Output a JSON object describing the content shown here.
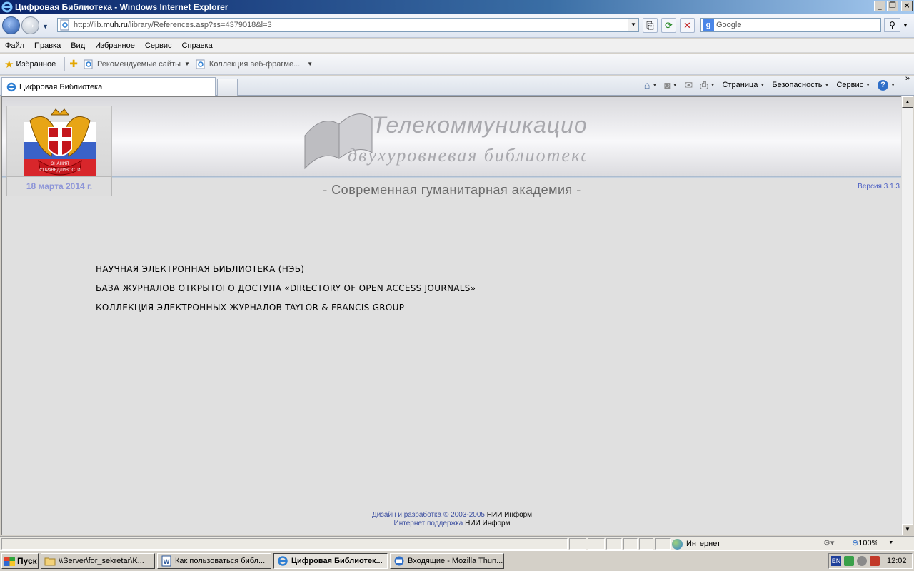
{
  "window": {
    "title": "Цифровая Библиотека - Windows Internet Explorer"
  },
  "address": {
    "url_prefix": "http://lib.",
    "url_host": "muh.ru",
    "url_rest": "/library/References.asp?ss=4379018&l=3"
  },
  "search": {
    "placeholder": "Google"
  },
  "menu": [
    "Файл",
    "Правка",
    "Вид",
    "Избранное",
    "Сервис",
    "Справка"
  ],
  "favorites": {
    "label": "Избранное",
    "links": [
      "Рекомендуемые сайты",
      "Коллекция веб-фрагме..."
    ]
  },
  "tab": {
    "label": "Цифровая Библиотека"
  },
  "commandbar": {
    "page": "Страница",
    "security": "Безопасность",
    "service": "Сервис"
  },
  "page": {
    "date": "18 марта 2014 г.",
    "subtitle": "- Современная гуманитарная академия -",
    "version": "Версия 3.1.3",
    "banner_line1": "Телекоммуникационная",
    "banner_line2": "двухуровневая библиотека",
    "crest_text_top": "ЗНАНИЯ",
    "crest_text_bottom": "СПРАВЕДЛИВОСТИ",
    "links": [
      "НАУЧНАЯ ЭЛЕКТРОННАЯ БИБЛИОТЕКА (НЭБ)",
      "БАЗА ЖУРНАЛОВ ОТКРЫТОГО ДОСТУПА «DIRECTORY OF OPEN ACCESS JOURNALS»",
      "КОЛЛЕКЦИЯ ЭЛЕКТРОННЫХ ЖУРНАЛОВ TAYLOR & FRANCIS GROUP"
    ],
    "footer": {
      "design": "Дизайн и разработка © 2003-2005",
      "design_org": "НИИ Информ",
      "support": "Интернет поддержка",
      "support_org": "НИИ Информ"
    }
  },
  "statusbar": {
    "zone": "Интернет",
    "zoom": "100%"
  },
  "taskbar": {
    "start": "Пуск",
    "tasks": [
      "\\\\Server\\for_sekretar\\K...",
      "Как пользоваться библ...",
      "Цифровая Библиотек...",
      "Входящие - Mozilla Thun..."
    ],
    "lang": "EN",
    "clock": "12:02"
  }
}
